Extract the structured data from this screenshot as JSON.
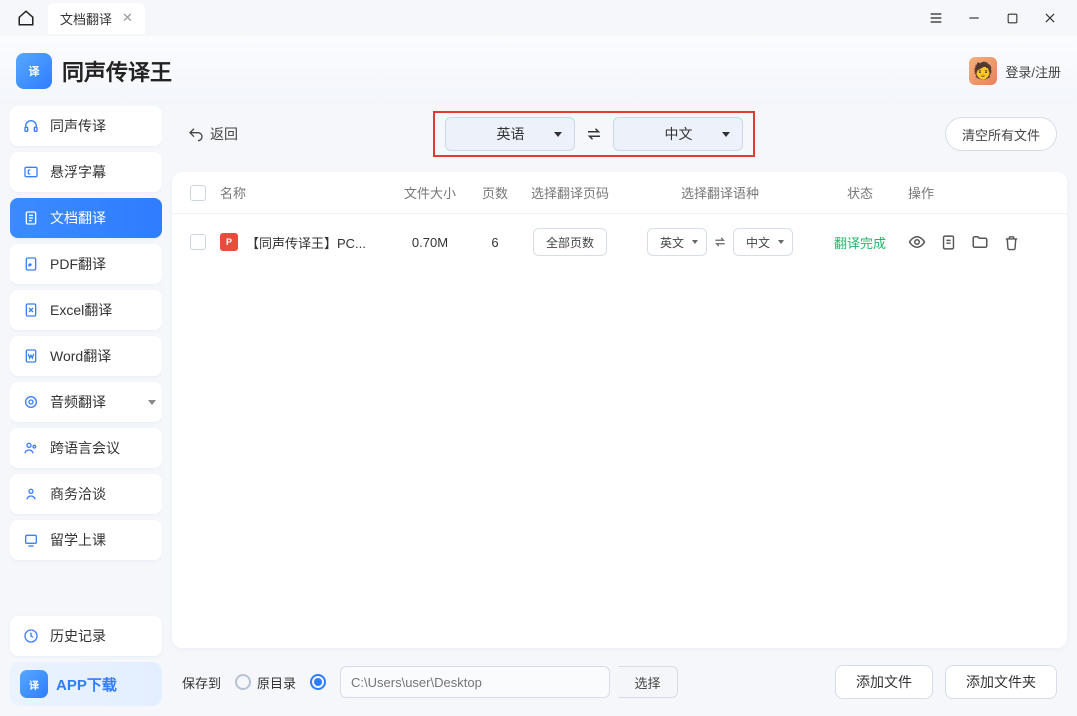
{
  "titlebar": {
    "tab_label": "文档翻译"
  },
  "header": {
    "app_name": "同声传译王",
    "login_label": "登录/注册"
  },
  "sidebar": {
    "items": [
      {
        "label": "同声传译"
      },
      {
        "label": "悬浮字幕"
      },
      {
        "label": "文档翻译"
      },
      {
        "label": "PDF翻译"
      },
      {
        "label": "Excel翻译"
      },
      {
        "label": "Word翻译"
      },
      {
        "label": "音频翻译"
      },
      {
        "label": "跨语言会议"
      },
      {
        "label": "商务洽谈"
      },
      {
        "label": "留学上课"
      }
    ],
    "history_label": "历史记录",
    "download_label": "APP下载"
  },
  "toolbar": {
    "back_label": "返回",
    "source_lang": "英语",
    "target_lang": "中文",
    "clear_label": "清空所有文件"
  },
  "table": {
    "headers": {
      "name": "名称",
      "size": "文件大小",
      "pages": "页数",
      "page_select": "选择翻译页码",
      "lang_select": "选择翻译语种",
      "status": "状态",
      "ops": "操作"
    },
    "rows": [
      {
        "filename": "【同声传译王】PC...",
        "size": "0.70M",
        "pages": "6",
        "page_select_label": "全部页数",
        "src_lang": "英文",
        "tgt_lang": "中文",
        "status": "翻译完成"
      }
    ]
  },
  "footer": {
    "save_to_label": "保存到",
    "orig_dir_label": "原目录",
    "path_placeholder": "C:\\Users\\user\\Desktop",
    "select_label": "选择",
    "add_file_label": "添加文件",
    "add_folder_label": "添加文件夹"
  }
}
